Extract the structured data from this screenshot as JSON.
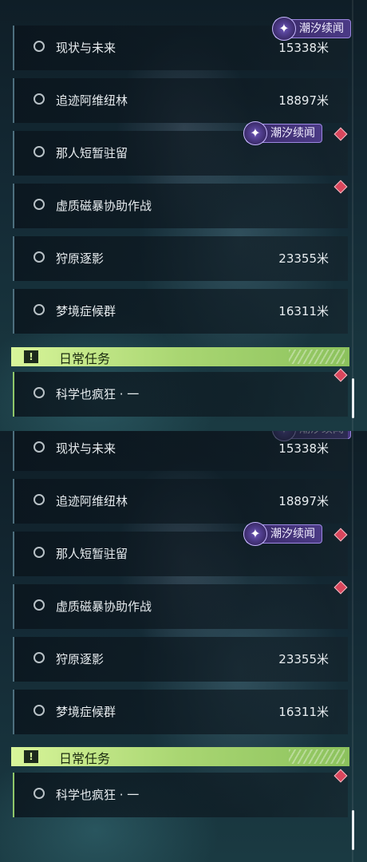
{
  "tag_label": "潮汐续闻",
  "tag_icon": "✦",
  "daily_header": {
    "icon": "!",
    "title": "日常任务"
  },
  "quests": [
    {
      "name": "现状与未来",
      "distance": "15338米"
    },
    {
      "name": "追迹阿维纽林",
      "distance": "18897米"
    },
    {
      "name": "那人短暂驻留",
      "distance": ""
    },
    {
      "name": "虚质磁暴协助作战",
      "distance": ""
    },
    {
      "name": "狩原逐影",
      "distance": "23355米"
    },
    {
      "name": "梦境症候群",
      "distance": "16311米"
    }
  ],
  "daily_quests": [
    {
      "name": "科学也疯狂 · 一"
    }
  ],
  "colors": {
    "tag_bg": "#4b3a86",
    "daily_header": "#a9d672",
    "tracking_marker": "#d9465c"
  },
  "icons": [
    "empty-circle-icon",
    "tidal-story-icon",
    "exclamation-icon",
    "tracking-diamond-icon"
  ]
}
